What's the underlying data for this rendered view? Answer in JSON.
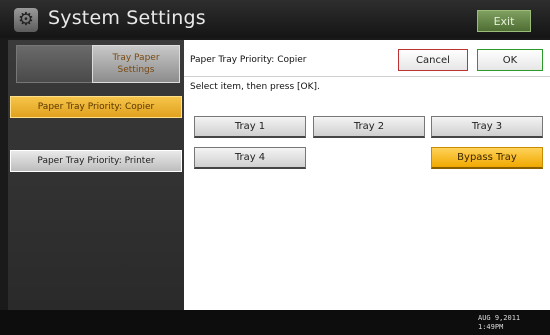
{
  "header": {
    "title": "System Settings",
    "icon": "gear-icon",
    "exit_label": "Exit"
  },
  "left_panel": {
    "active_tab_label": "Tray Paper Settings",
    "items": [
      {
        "label": "Paper Tray Priority: Copier",
        "selected": true
      },
      {
        "label": "Paper Tray Priority: Printer",
        "selected": false
      }
    ]
  },
  "dialog": {
    "title": "Paper Tray Priority: Copier",
    "cancel_label": "Cancel",
    "ok_label": "OK",
    "instruction": "Select item, then press [OK].",
    "trays": [
      {
        "label": "Tray 1",
        "selected": false
      },
      {
        "label": "Tray 2",
        "selected": false
      },
      {
        "label": "Tray 3",
        "selected": false
      },
      {
        "label": "Tray 4",
        "selected": false
      },
      {
        "label": "Bypass Tray",
        "selected": true
      }
    ]
  },
  "status": {
    "date": "AUG   9,2011",
    "time": "1:49PM"
  },
  "colors": {
    "selected": "#f2b01e",
    "header_bg": "#1e1e1e",
    "exit_green": "#5f7f45"
  }
}
